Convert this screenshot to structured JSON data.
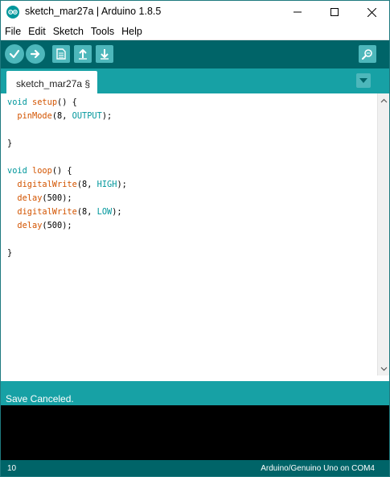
{
  "window": {
    "title": "sketch_mar27a | Arduino 1.8.5",
    "icon": "arduino-logo-icon"
  },
  "menu": {
    "items": [
      "File",
      "Edit",
      "Sketch",
      "Tools",
      "Help"
    ]
  },
  "toolbar": {
    "buttons": [
      "verify-icon",
      "upload-icon",
      "new-icon",
      "open-icon",
      "save-icon",
      "serial-monitor-icon"
    ]
  },
  "tabs": {
    "active_label": "sketch_mar27a §"
  },
  "editor": {
    "lines": [
      "void setup() {",
      "  pinMode(8, OUTPUT);",
      "",
      "}",
      "",
      "void loop() {",
      "  digitalWrite(8, HIGH);",
      "  delay(500);",
      "  digitalWrite(8, LOW);",
      "  delay(500);",
      "",
      "}"
    ]
  },
  "status": {
    "message": "Save Canceled."
  },
  "footer": {
    "line_number": "10",
    "board": "Arduino/Genuino Uno on COM4"
  },
  "colors": {
    "toolbar_bg": "#006468",
    "tabstrip_bg": "#17a1a5",
    "button_bg": "#4db7bb",
    "keyword": "#00979c",
    "function": "#d35400"
  }
}
